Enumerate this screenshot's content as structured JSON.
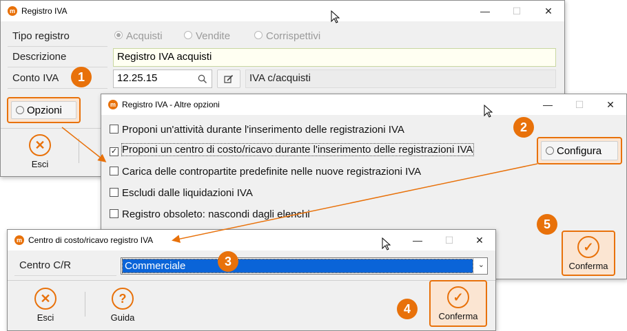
{
  "win1": {
    "title": "Registro IVA",
    "controls": {
      "minimize": "—",
      "maximize": "☐",
      "close": "✕"
    },
    "tipo_label": "Tipo registro",
    "radios": [
      "Acquisti",
      "Vendite",
      "Corrispettivi"
    ],
    "descrizione_label": "Descrizione",
    "descrizione_value": "Registro IVA acquisti",
    "conto_label": "Conto IVA",
    "conto_value": "12.25.15",
    "conto_desc": "IVA c/acquisti",
    "opzioni_label": "Opzioni",
    "esci_label": "Esci"
  },
  "win2": {
    "title": "Registro IVA - Altre opzioni",
    "controls": {
      "minimize": "—",
      "maximize": "☐",
      "close": "✕"
    },
    "checks": [
      {
        "label": "Proponi un'attività durante l'inserimento delle registrazioni IVA",
        "checked": false
      },
      {
        "label": "Proponi un centro di costo/ricavo durante l'inserimento delle registrazioni IVA",
        "checked": true
      },
      {
        "label": "Carica delle contropartite predefinite nelle nuove registrazioni IVA",
        "checked": false
      },
      {
        "label": "Escludi dalle liquidazioni IVA",
        "checked": false
      },
      {
        "label": "Registro obsoleto: nascondi dagli elenchi",
        "checked": false
      }
    ],
    "configura_label": "Configura",
    "conferma_label": "Conferma"
  },
  "win3": {
    "title": "Centro di costo/ricavo registro IVA",
    "controls": {
      "minimize": "—",
      "maximize": "☐",
      "close": "✕"
    },
    "centro_label": "Centro C/R",
    "centro_value": "Commerciale",
    "esci_label": "Esci",
    "guida_label": "Guida",
    "conferma_label": "Conferma"
  },
  "callouts": [
    "1",
    "2",
    "3",
    "4",
    "5"
  ],
  "colors": {
    "accent": "#e8710a",
    "selection": "#0a64d8"
  }
}
